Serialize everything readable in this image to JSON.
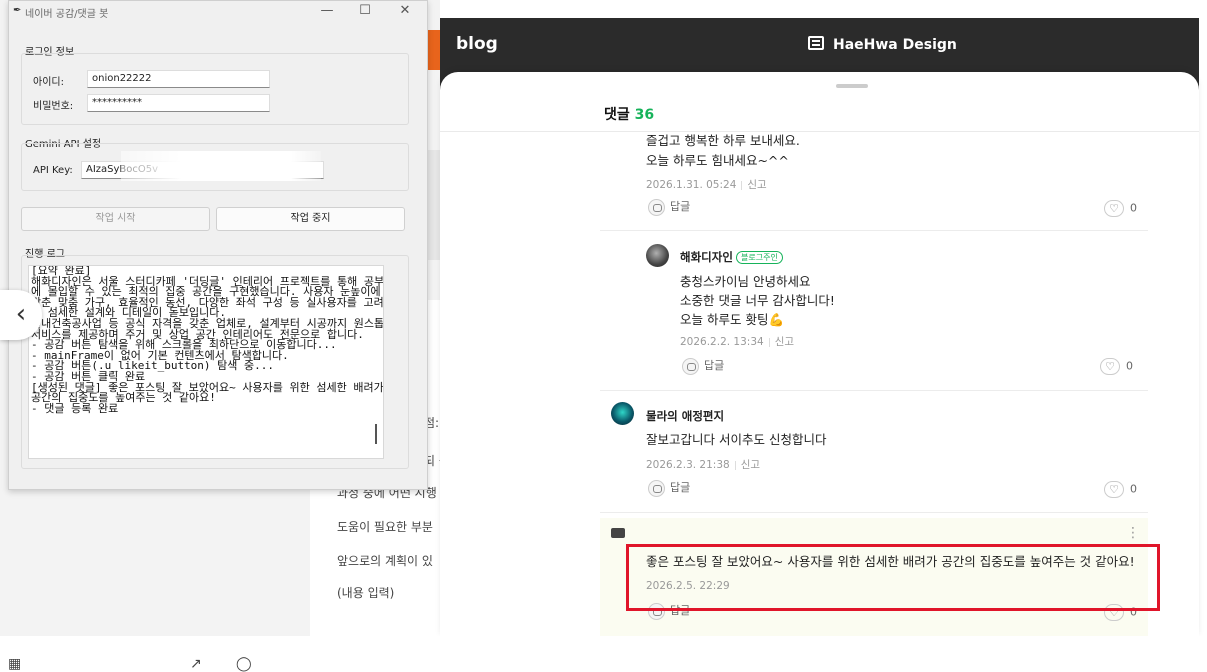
{
  "background": {
    "texts": [
      {
        "text": "점:"
      },
      {
        "text": "되 공"
      },
      {
        "text": "과정 중에 어떤 시행"
      },
      {
        "text": "도움이 필요한 부분"
      },
      {
        "text": "앞으로의 계획이 있"
      },
      {
        "text": "(내용 입력)"
      }
    ]
  },
  "app": {
    "title": "네이버 공감/댓글 봇",
    "login_section": "로그인 정보",
    "id_label": "아이디:",
    "id_value": "onion22222",
    "pw_label": "비밀번호:",
    "pw_value": "**********",
    "gemini_section": "Gemini API 설정",
    "api_label": "API Key:",
    "api_value": "AIzaSyBocO5v",
    "start_button": "작업 시작",
    "stop_button": "작업 중지",
    "log_section": "진행 로그",
    "log_text": "[요약 완료]\n해화디자인은 서울 스터디카페 '더딩글' 인테리어 프로젝트를 통해 공부에 몰입할 수 있는 최적의 집중 공간을 구현했습니다. 사용자 눈높이에 맞춘 맞춤 가구, 효율적인 동선, 다양한 좌석 구성 등 실사용자를 고려한 섬세한 설계와 디테일이 돋보입니다.\n실내건축공사업 등 공식 자격을 갖춘 업체로, 설계부터 시공까지 원스톱 서비스를 제공하며 주거 및 상업 공간 인테리어도 전문으로 합니다.\n- 공감 버튼 탐색을 위해 스크롤을 최하단으로 이동합니다...\n- mainFrame이 없어 기본 컨텐츠에서 탐색합니다.\n- 공감 버튼(.u_likeit_button) 탐색 중...\n- 공감 버튼 클릭 완료\n[생성된 댓글] 좋은 포스팅 잘 보았어요~ 사용자를 위한 섬세한 배려가 공간의 집중도를 높여주는 것 같아요!\n- 댓글 등록 완료",
    "win_minimize": "—",
    "win_maximize": "☐",
    "win_close": "✕"
  },
  "blog": {
    "logo": "blog",
    "header_title": "HaeHwa Design",
    "comments_label": "댓글",
    "comments_count": "36",
    "reply_label": "답글",
    "report_label": "신고",
    "comments": [
      {
        "lines": [
          "즐겁고 행복한 하루 보내세요.",
          "오늘 하루도 힘내세요~^^"
        ],
        "date": "2026.1.31. 05:24",
        "likes": "0"
      },
      {
        "author": "해화디자인",
        "badge": "블로그주인",
        "lines": [
          "충청스카이님 안녕하세요",
          "소중한 댓글 너무 감사합니다!",
          "오늘 하루도 홧팅💪"
        ],
        "date": "2026.2.2. 13:34",
        "likes": "0"
      },
      {
        "author": "물라의 애정편지",
        "lines": [
          "잘보고갑니다 서이추도 신청합니다"
        ],
        "date": "2026.2.3. 21:38",
        "likes": "0"
      },
      {
        "author": "",
        "lines": [
          "좋은 포스팅 잘 보았어요~ 사용자를 위한 섬세한 배려가 공간의 집중도를 높여주는 것 같아요!"
        ],
        "date": "2026.2.5. 22:29",
        "likes": "0"
      }
    ]
  },
  "colors": {
    "accent_green": "#16b35a",
    "highlight_red": "#e0152a",
    "header_dark": "#2b2b2b",
    "orange": "#e8641c"
  },
  "icons": {
    "prev": "chevron-left-icon",
    "menu": "menu-icon",
    "reply": "speech-bubble-icon",
    "like": "heart-icon"
  }
}
